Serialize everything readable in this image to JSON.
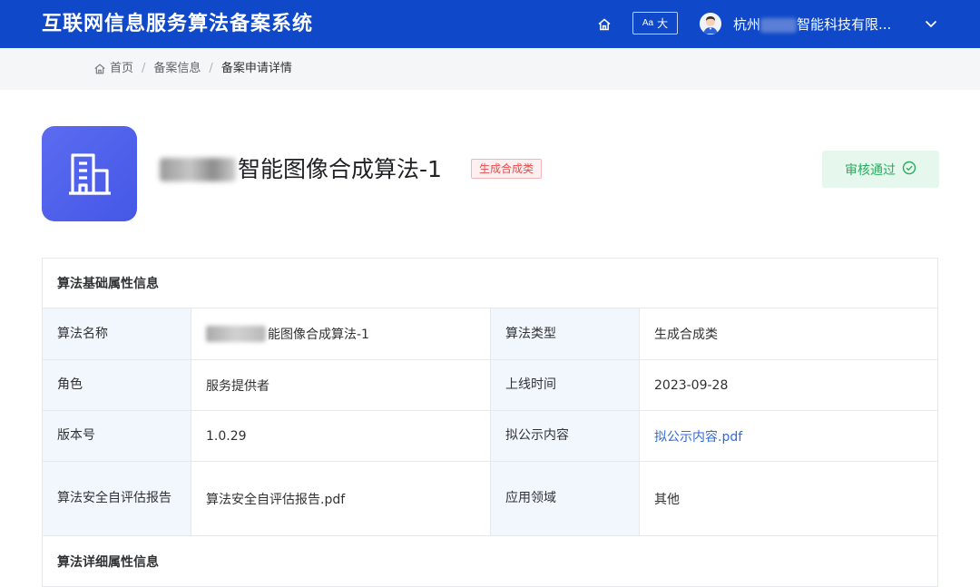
{
  "header": {
    "app_title": "互联网信息服务算法备案系统",
    "font_toggle_small": "Aa",
    "font_toggle_big": "大",
    "user_name_prefix": "杭州",
    "user_name_suffix": "智能科技有限...",
    "icons": [
      "home-icon",
      "user-avatar",
      "chevron-down-icon"
    ]
  },
  "breadcrumb": {
    "home": "首页",
    "level2": "备案信息",
    "current": "备案申请详情"
  },
  "algorithm": {
    "title": "智能图像合成算法-1",
    "type_tag": "生成合成类",
    "status": "审核通过",
    "colors": {
      "primary": "#0f49c9",
      "icon_bg": "#4a5ce8",
      "tag_red": "#e34b4b",
      "status_green": "#2aab5f",
      "link": "#2f6bdc"
    }
  },
  "basic_info": {
    "section_title": "算法基础属性信息",
    "rows": [
      {
        "label_left": "算法名称",
        "value_left": "能图像合成算法-1",
        "label_right": "算法类型",
        "value_right": "生成合成类"
      },
      {
        "label_left": "角色",
        "value_left": "服务提供者",
        "label_right": "上线时间",
        "value_right": "2023-09-28"
      },
      {
        "label_left": "版本号",
        "value_left": "1.0.29",
        "label_right": "拟公示内容",
        "value_right": "拟公示内容.pdf"
      },
      {
        "label_left": "算法安全自评估报告",
        "value_left": "算法安全自评估报告.pdf",
        "label_right": "应用领域",
        "value_right": "其他"
      }
    ]
  },
  "detail_info": {
    "section_title": "算法详细属性信息"
  }
}
